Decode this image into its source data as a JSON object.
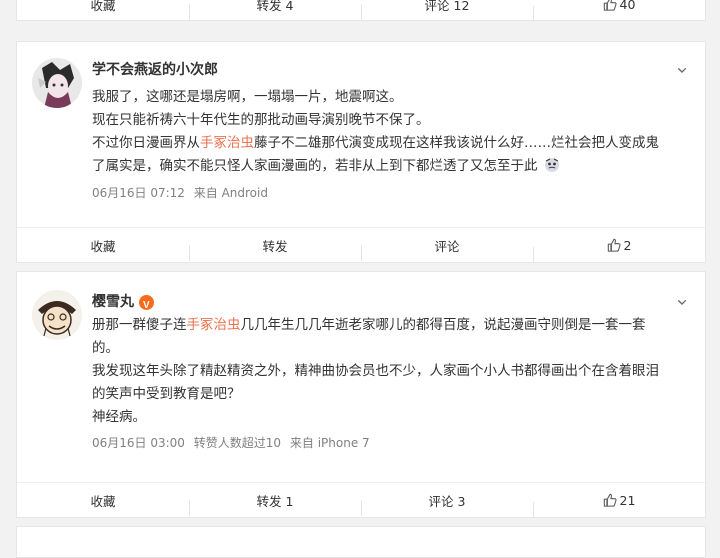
{
  "top_bar": {
    "favorite": "收藏",
    "repost": "转发 4",
    "comment": "评论 12",
    "like": "40"
  },
  "post1": {
    "username": "学不会燕返的小次郎",
    "line1": "我服了，这哪还是塌房啊，一塌塌一片，地震啊这。",
    "line2": "现在只能祈祷六十年代生的那批动画导演别晚节不保了。",
    "line3_before": "不过你日漫画界从",
    "line3_link": "手冢治虫",
    "line3_after": "藤子不二雄那代演变成现在这样我该说什么好……烂社会把人变成鬼",
    "line4": "了属实是，确实不能只怪人家画漫画的，若非从上到下都烂透了又怎至于此",
    "date": "06月16日 07:12",
    "source": "来自 Android",
    "actions": {
      "favorite": "收藏",
      "repost": "转发",
      "comment": "评论",
      "like": "2"
    }
  },
  "post2": {
    "username": "樱雪丸",
    "line1_before": "册那一群傻子连",
    "line1_link": "手冢治虫",
    "line1_after": "几几年生几几年逝老家哪儿的都得百度，说起漫画守则倒是一套一套",
    "line2": "的。",
    "line3": "我发现这年头除了精赵精资之外，精神曲协会员也不少，人家画个小人书都得画出个在含着眼泪",
    "line4": "的笑声中受到教育是吧？",
    "line5": "神经病。",
    "date": "06月16日 03:00",
    "reposts_note": "转赞人数超过10",
    "source": "来自 iPhone 7",
    "actions": {
      "favorite": "收藏",
      "repost": "转发 1",
      "comment": "评论 3",
      "like": "21"
    }
  },
  "colors": {
    "link": "#eb7350",
    "meta": "#808080",
    "verified": "#f76b1c"
  }
}
